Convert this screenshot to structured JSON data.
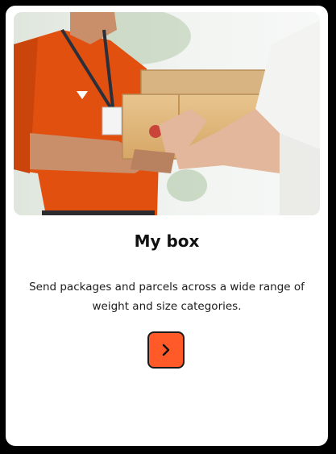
{
  "card": {
    "title": "My box",
    "description": "Send packages and parcels across a wide range of weight and size categories.",
    "image_alt": "Courier handing over cardboard boxes",
    "next_icon": "chevron-right-icon"
  },
  "colors": {
    "accent": "#ff5a27",
    "uniform": "#e2500f",
    "page_background": "#000000",
    "card_background": "#ffffff"
  }
}
